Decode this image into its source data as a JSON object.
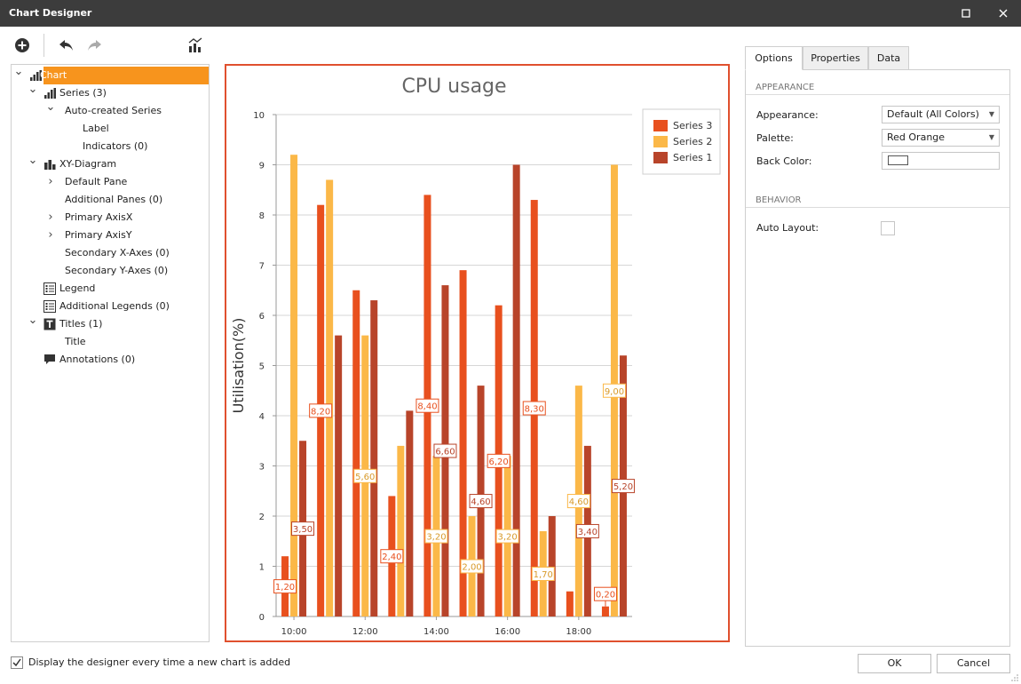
{
  "window": {
    "title": "Chart Designer"
  },
  "tree": [
    {
      "id": "chart",
      "label": "Chart",
      "level": 0,
      "arrow": "down",
      "icon": "bar-chart-icon",
      "selected": true
    },
    {
      "id": "series",
      "label": "Series (3)",
      "level": 1,
      "arrow": "down",
      "icon": "bar-chart-icon"
    },
    {
      "id": "auto-series",
      "label": "Auto-created Series",
      "level": 2,
      "arrow": "down",
      "icon": ""
    },
    {
      "id": "label",
      "label": "Label",
      "level": 3,
      "arrow": "",
      "icon": ""
    },
    {
      "id": "indicators",
      "label": "Indicators (0)",
      "level": 3,
      "arrow": "",
      "icon": ""
    },
    {
      "id": "xy-diagram",
      "label": "XY-Diagram",
      "level": 1,
      "arrow": "down",
      "icon": "diagram-icon"
    },
    {
      "id": "default-pane",
      "label": "Default Pane",
      "level": 2,
      "arrow": "right",
      "icon": ""
    },
    {
      "id": "additional-panes",
      "label": "Additional Panes (0)",
      "level": 2,
      "arrow": "",
      "icon": ""
    },
    {
      "id": "primary-axis-x",
      "label": "Primary AxisX",
      "level": 2,
      "arrow": "right",
      "icon": ""
    },
    {
      "id": "primary-axis-y",
      "label": "Primary AxisY",
      "level": 2,
      "arrow": "right",
      "icon": ""
    },
    {
      "id": "secondary-x-axes",
      "label": "Secondary X-Axes (0)",
      "level": 2,
      "arrow": "",
      "icon": ""
    },
    {
      "id": "secondary-y-axes",
      "label": "Secondary Y-Axes (0)",
      "level": 2,
      "arrow": "",
      "icon": ""
    },
    {
      "id": "legend",
      "label": "Legend",
      "level": 1,
      "arrow": "",
      "icon": "legend-icon"
    },
    {
      "id": "additional-legends",
      "label": "Additional Legends (0)",
      "level": 1,
      "arrow": "",
      "icon": "legend-icon"
    },
    {
      "id": "titles",
      "label": "Titles (1)",
      "level": 1,
      "arrow": "down",
      "icon": "title-icon"
    },
    {
      "id": "title",
      "label": "Title",
      "level": 2,
      "arrow": "",
      "icon": ""
    },
    {
      "id": "annotations",
      "label": "Annotations (0)",
      "level": 1,
      "arrow": "",
      "icon": "annotation-icon"
    }
  ],
  "tabs": [
    {
      "label": "Options",
      "active": true
    },
    {
      "label": "Properties",
      "active": false
    },
    {
      "label": "Data",
      "active": false
    }
  ],
  "options": {
    "appearance_header": "APPEARANCE",
    "appearance_label": "Appearance:",
    "appearance_value": "Default (All Colors)",
    "palette_label": "Palette:",
    "palette_value": "Red Orange",
    "back_color_label": "Back Color:",
    "behavior_header": "BEHAVIOR",
    "auto_layout_label": "Auto Layout:",
    "auto_layout_checked": false
  },
  "footer": {
    "checkbox_label": "Display the designer every time a new chart is added",
    "checkbox_checked": true,
    "ok_label": "OK",
    "cancel_label": "Cancel"
  },
  "colors": {
    "accent": "#f7941d",
    "chart_border": "#e0502e",
    "series3": "#e8501e",
    "series2": "#fbb848",
    "series1": "#b8442a"
  },
  "chart_data": {
    "type": "bar",
    "title": "CPU usage",
    "ylabel": "Utilisation(%)",
    "xlabel": "",
    "ylim": [
      0,
      10
    ],
    "yticks": [
      0,
      1,
      2,
      3,
      4,
      5,
      6,
      7,
      8,
      9,
      10
    ],
    "xtick_labels": [
      "10:00",
      "12:00",
      "14:00",
      "16:00",
      "18:00"
    ],
    "xtick_category_index": [
      0,
      2,
      4,
      6,
      8
    ],
    "categories_count": 10,
    "legend_position": "top-right",
    "grid": true,
    "series": [
      {
        "name": "Series 3",
        "color": "#e8501e",
        "values": [
          1.2,
          8.2,
          6.5,
          2.4,
          8.4,
          6.9,
          6.2,
          8.3,
          0.5,
          0.2
        ],
        "labeled": [
          true,
          true,
          false,
          true,
          true,
          false,
          true,
          true,
          false,
          true
        ]
      },
      {
        "name": "Series 2",
        "color": "#fbb848",
        "values": [
          9.2,
          8.7,
          5.6,
          3.4,
          3.2,
          2.0,
          3.2,
          1.7,
          4.6,
          9.0
        ],
        "labeled": [
          false,
          false,
          true,
          false,
          true,
          true,
          true,
          true,
          true,
          true
        ]
      },
      {
        "name": "Series 1",
        "color": "#b8442a",
        "values": [
          3.5,
          5.6,
          6.3,
          4.1,
          6.6,
          4.6,
          9.0,
          2.0,
          3.4,
          5.2
        ],
        "labeled": [
          true,
          false,
          false,
          false,
          true,
          true,
          false,
          false,
          true,
          true
        ]
      }
    ],
    "data_labels": [
      {
        "series": "Series 3",
        "category": 0,
        "text": "1,20"
      },
      {
        "series": "Series 3",
        "category": 1,
        "text": "8,20"
      },
      {
        "series": "Series 3",
        "category": 3,
        "text": "2,40"
      },
      {
        "series": "Series 3",
        "category": 4,
        "text": "8,40"
      },
      {
        "series": "Series 3",
        "category": 6,
        "text": "6,20"
      },
      {
        "series": "Series 3",
        "category": 7,
        "text": "8,30"
      },
      {
        "series": "Series 3",
        "category": 9,
        "text": "0,20"
      },
      {
        "series": "Series 2",
        "category": 2,
        "text": "5,60"
      },
      {
        "series": "Series 2",
        "category": 4,
        "text": "3,20"
      },
      {
        "series": "Series 2",
        "category": 5,
        "text": "2,00"
      },
      {
        "series": "Series 2",
        "category": 6,
        "text": "3,20"
      },
      {
        "series": "Series 2",
        "category": 7,
        "text": "1,70"
      },
      {
        "series": "Series 2",
        "category": 8,
        "text": "4,60"
      },
      {
        "series": "Series 2",
        "category": 9,
        "text": "9,00"
      },
      {
        "series": "Series 1",
        "category": 0,
        "text": "3,50"
      },
      {
        "series": "Series 1",
        "category": 4,
        "text": "6,60"
      },
      {
        "series": "Series 1",
        "category": 5,
        "text": "4,60"
      },
      {
        "series": "Series 1",
        "category": 8,
        "text": "3,40"
      },
      {
        "series": "Series 1",
        "category": 9,
        "text": "5,20"
      }
    ]
  }
}
